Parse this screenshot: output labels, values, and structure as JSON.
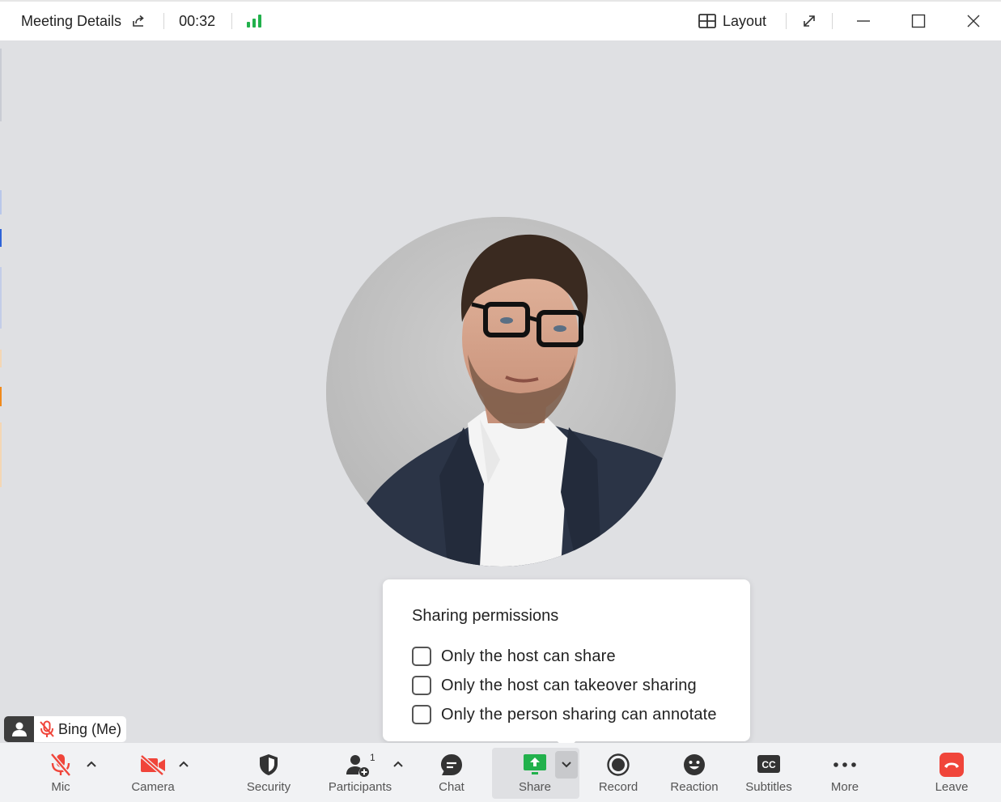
{
  "titlebar": {
    "title": "Meeting Details",
    "timer": "00:32",
    "layout_label": "Layout"
  },
  "popover": {
    "title": "Sharing permissions",
    "options": [
      {
        "label": "Only the host can share",
        "checked": false
      },
      {
        "label": "Only the host can takeover sharing",
        "checked": false
      },
      {
        "label": "Only the person sharing can annotate",
        "checked": false
      }
    ]
  },
  "nametag": {
    "name": "Bing (Me)"
  },
  "toolbar": {
    "mic": "Mic",
    "camera": "Camera",
    "security": "Security",
    "participants": "Participants",
    "participants_count": "1",
    "chat": "Chat",
    "share": "Share",
    "record": "Record",
    "reaction": "Reaction",
    "subtitles": "Subtitles",
    "more": "More",
    "leave": "Leave"
  },
  "colors": {
    "signal": "#22b14c",
    "muted_red": "#f0453a",
    "share_green": "#22b14c",
    "leave_red": "#f0453a"
  }
}
